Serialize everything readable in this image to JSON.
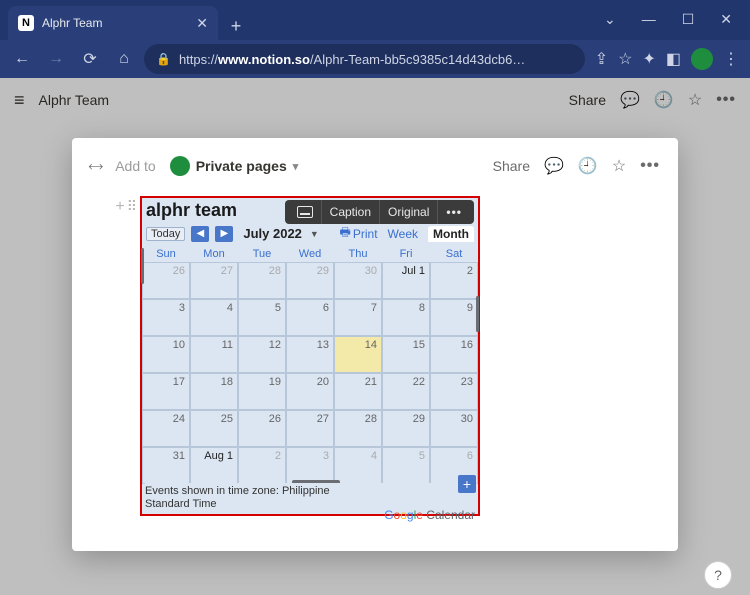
{
  "browser": {
    "tab_title": "Alphr Team",
    "favicon_letter": "N",
    "url_prefix": "https://",
    "url_host": "www.notion.so",
    "url_path": "/Alphr-Team-bb5c9385c14d43dcb6…"
  },
  "notion": {
    "page_title": "Alphr Team",
    "share_label": "Share"
  },
  "modal": {
    "add_to_label": "Add to",
    "private_pages_label": "Private pages",
    "share_label": "Share"
  },
  "block_toolbar": {
    "caption": "Caption",
    "original": "Original"
  },
  "calendar": {
    "title": "alphr team",
    "today_label": "Today",
    "month_label": "July 2022",
    "print_label": "Print",
    "view_week": "Week",
    "view_month": "Month",
    "day_headers": [
      "Sun",
      "Mon",
      "Tue",
      "Wed",
      "Thu",
      "Fri",
      "Sat"
    ],
    "cells": [
      {
        "t": "26",
        "out": true
      },
      {
        "t": "27",
        "out": true
      },
      {
        "t": "28",
        "out": true
      },
      {
        "t": "29",
        "out": true
      },
      {
        "t": "30",
        "out": true
      },
      {
        "t": "Jul 1",
        "first": true
      },
      {
        "t": "2"
      },
      {
        "t": "3"
      },
      {
        "t": "4"
      },
      {
        "t": "5"
      },
      {
        "t": "6"
      },
      {
        "t": "7"
      },
      {
        "t": "8"
      },
      {
        "t": "9"
      },
      {
        "t": "10"
      },
      {
        "t": "11"
      },
      {
        "t": "12"
      },
      {
        "t": "13"
      },
      {
        "t": "14",
        "today": true
      },
      {
        "t": "15"
      },
      {
        "t": "16"
      },
      {
        "t": "17"
      },
      {
        "t": "18"
      },
      {
        "t": "19"
      },
      {
        "t": "20"
      },
      {
        "t": "21"
      },
      {
        "t": "22"
      },
      {
        "t": "23"
      },
      {
        "t": "24"
      },
      {
        "t": "25"
      },
      {
        "t": "26"
      },
      {
        "t": "27"
      },
      {
        "t": "28"
      },
      {
        "t": "29"
      },
      {
        "t": "30"
      },
      {
        "t": "31"
      },
      {
        "t": "Aug 1",
        "out": true,
        "first": true
      },
      {
        "t": "2",
        "out": true
      },
      {
        "t": "3",
        "out": true
      },
      {
        "t": "4",
        "out": true
      },
      {
        "t": "5",
        "out": true
      },
      {
        "t": "6",
        "out": true
      }
    ],
    "timezone_text": "Events shown in time zone: Philippine Standard Time",
    "brand_calendar": "Calendar"
  },
  "help_label": "?"
}
